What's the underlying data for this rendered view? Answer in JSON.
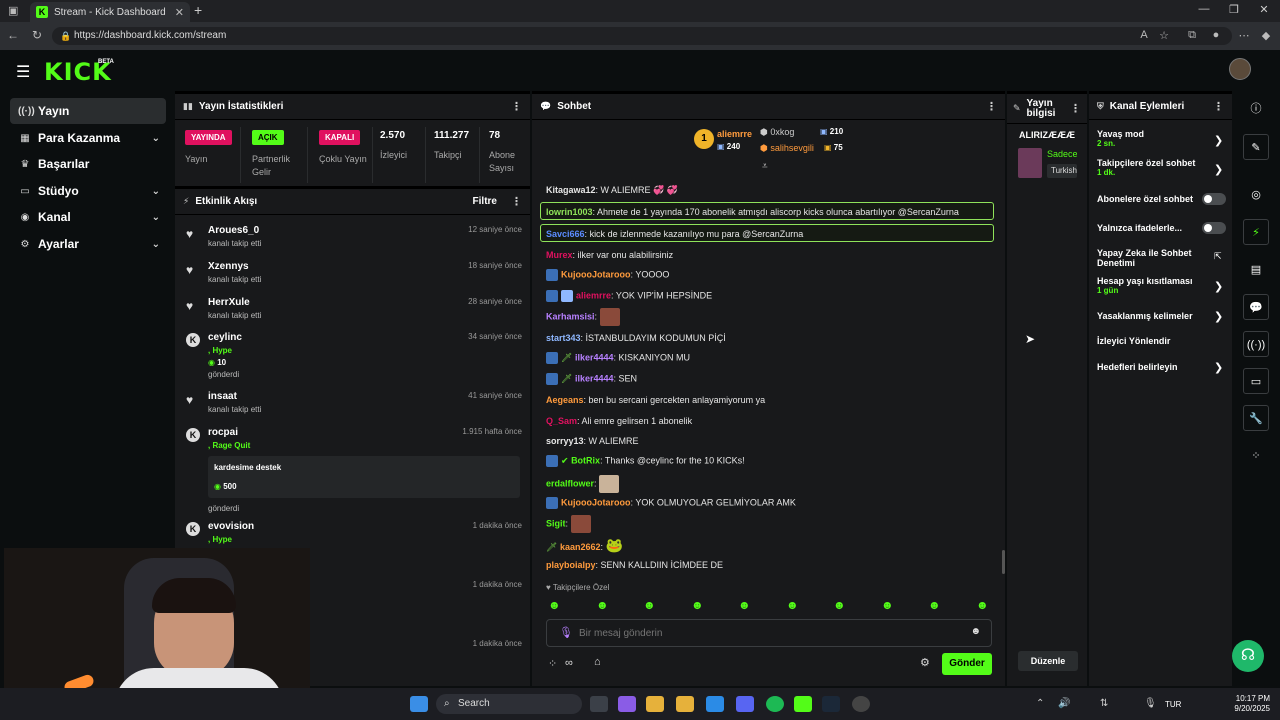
{
  "browser": {
    "tab_title": "Stream - Kick Dashboard",
    "url": "https://dashboard.kick.com/stream",
    "tab_icon": "kick-icon"
  },
  "brand": {
    "logo": "KICK",
    "beta": "BETA",
    "accent": "#53fc18"
  },
  "sidebar": {
    "items": [
      {
        "label": "Yayın",
        "icon": "broadcast-icon"
      },
      {
        "label": "Para Kazanma",
        "icon": "money-icon"
      },
      {
        "label": "Başarılar",
        "icon": "trophy-icon"
      },
      {
        "label": "Stüdyo",
        "icon": "studio-icon"
      },
      {
        "label": "Kanal",
        "icon": "channel-icon"
      },
      {
        "label": "Ayarlar",
        "icon": "settings-icon"
      }
    ]
  },
  "stats": {
    "title": "Yayın İstatistikleri",
    "items": [
      {
        "badge": "YAYINDA",
        "label": "Yayın",
        "color": "#e0115f"
      },
      {
        "badge": "AÇIK",
        "label": "Partnerlik Gelir",
        "color": "#53fc18"
      },
      {
        "badge": "KAPALI",
        "label": "Çoklu Yayın",
        "color": "#e0115f"
      },
      {
        "value": "2.570",
        "label": "İzleyici"
      },
      {
        "value": "111.277",
        "label": "Takipçi"
      },
      {
        "value": "78",
        "label": "Abone Sayısı"
      }
    ]
  },
  "activity": {
    "title": "Etkinlik Akışı",
    "filter": "Filtre",
    "items": [
      {
        "name": "Aroues6_0",
        "sub": "kanalı takip etti",
        "time": "12 saniye önce"
      },
      {
        "name": "Xzennys",
        "sub": "kanalı takip etti",
        "time": "18 saniye önce"
      },
      {
        "name": "HerrXule",
        "sub": "kanalı takip etti",
        "time": "28 saniye önce"
      },
      {
        "name": "ceylinc",
        "tag": ", Hype",
        "amount": "10",
        "sub": "gönderdi",
        "time": "34 saniye önce"
      },
      {
        "name": "insaat",
        "sub": "kanalı takip etti",
        "time": "41 saniye önce"
      },
      {
        "name": "rocpai",
        "tag": ", Rage Quit",
        "msg": "kardesime destek",
        "amount": "500",
        "sub": "gönderdi",
        "time": "1.915 hafta önce"
      },
      {
        "name": "evovision",
        "tag": ", Hype",
        "time": "1 dakika önce"
      },
      {
        "time": "1 dakika önce"
      },
      {
        "time": "1 dakika önce"
      }
    ]
  },
  "chat": {
    "title": "Sohbet",
    "top_gifters": [
      {
        "rank": "1",
        "name": "aliemrre",
        "count": "240"
      },
      {
        "name": "0xkog",
        "count": "210"
      },
      {
        "name": "salihsevgili",
        "count": "75"
      }
    ],
    "messages": [
      {
        "user": "Kitagawa12",
        "color": "#e6e6e6",
        "text": "W ALIEMRE 💞 💞"
      },
      {
        "user": "lowrin1003",
        "color": "#8fe35a",
        "text": "Ahmete de 1 yayında 170 abonelik atmışdı aliscorp kicks olunca abartılıyor @SercanZurna",
        "highlight": true
      },
      {
        "user": "Savci666",
        "color": "#5b8cff",
        "text": "kick de izlenmede kazanılıyo mu para @SercanZurna",
        "highlight": true
      },
      {
        "user": "Murex",
        "color": "#e0115f",
        "text": "ilker var onu alabilirsiniz"
      },
      {
        "user": "KujoooJotarooo",
        "color": "#ff9b3d",
        "text": "YOOOO"
      },
      {
        "user": "aliemrre",
        "color": "#e0115f",
        "text": "YOK VIP'İM HEPSİNDE"
      },
      {
        "user": "Karhamsisi",
        "color": "#b780ff",
        "text": ""
      },
      {
        "user": "start343",
        "color": "#8fb8ff",
        "text": "İSTANBULDAYIM KODUMUN PİÇİ"
      },
      {
        "user": "ilker4444",
        "color": "#b780ff",
        "text": "KISKANIYON MU"
      },
      {
        "user": "ilker4444",
        "color": "#b780ff",
        "text": "SEN"
      },
      {
        "user": "Aegeans",
        "color": "#ff9b3d",
        "text": "ben bu sercani gercekten anlayamiyorum ya"
      },
      {
        "user": "Q_Sam",
        "color": "#e0115f",
        "text": "Ali emre gelirsen 1 abonelik"
      },
      {
        "user": "sorryy13",
        "color": "#e6e6e6",
        "text": "W ALIEMRE"
      },
      {
        "user": "BotRix",
        "color": "#53fc18",
        "text": "Thanks @ceylinc for the 10 KICKs!"
      },
      {
        "user": "erdalflower",
        "color": "#53fc18",
        "text": ""
      },
      {
        "user": "KujoooJotarooo",
        "color": "#ff9b3d",
        "text": "YOK OLMUYOLAR GELMİYOLAR AMK"
      },
      {
        "user": "Sigit",
        "color": "#53fc18",
        "text": ""
      },
      {
        "user": "kaan2662",
        "color": "#ff9b3d",
        "text": ""
      },
      {
        "user": "playboialpy",
        "color": "#ff9b3d",
        "text": "SENN KALLDIIN İCİMDEE DE"
      }
    ],
    "followers_only": "Takipçilere Özel",
    "input_placeholder": "Bir mesaj gönderin",
    "send_label": "Gönder"
  },
  "stream_info": {
    "title": "Yayın bilgisi",
    "channel_title": "ALIRIZÆÆÆ",
    "preview_text": "Sadece",
    "language": "Turkish",
    "edit_label": "Düzenle"
  },
  "actions": {
    "title": "Kanal Eylemleri",
    "items": [
      {
        "label": "Yavaş mod",
        "value": "2 sn.",
        "control": "chevron"
      },
      {
        "label": "Takipçilere özel sohbet",
        "value": "1 dk.",
        "control": "chevron"
      },
      {
        "label": "Abonelere özel sohbet",
        "control": "toggle"
      },
      {
        "label": "Yalnızca ifadelerle...",
        "control": "toggle"
      },
      {
        "label": "Yapay Zeka ile Sohbet Denetimi",
        "control": "external"
      },
      {
        "label": "Hesap yaşı kısıtlaması",
        "value": "1 gün",
        "control": "chevron"
      },
      {
        "label": "Yasaklanmış kelimeler",
        "control": "chevron"
      },
      {
        "label": "İzleyici Yönlendir",
        "control": "none"
      },
      {
        "label": "Hedefleri belirleyin",
        "control": "chevron"
      }
    ]
  },
  "taskbar": {
    "search": "Search",
    "lang": "TUR",
    "time": "10:17 PM",
    "date": "9/20/2025"
  }
}
